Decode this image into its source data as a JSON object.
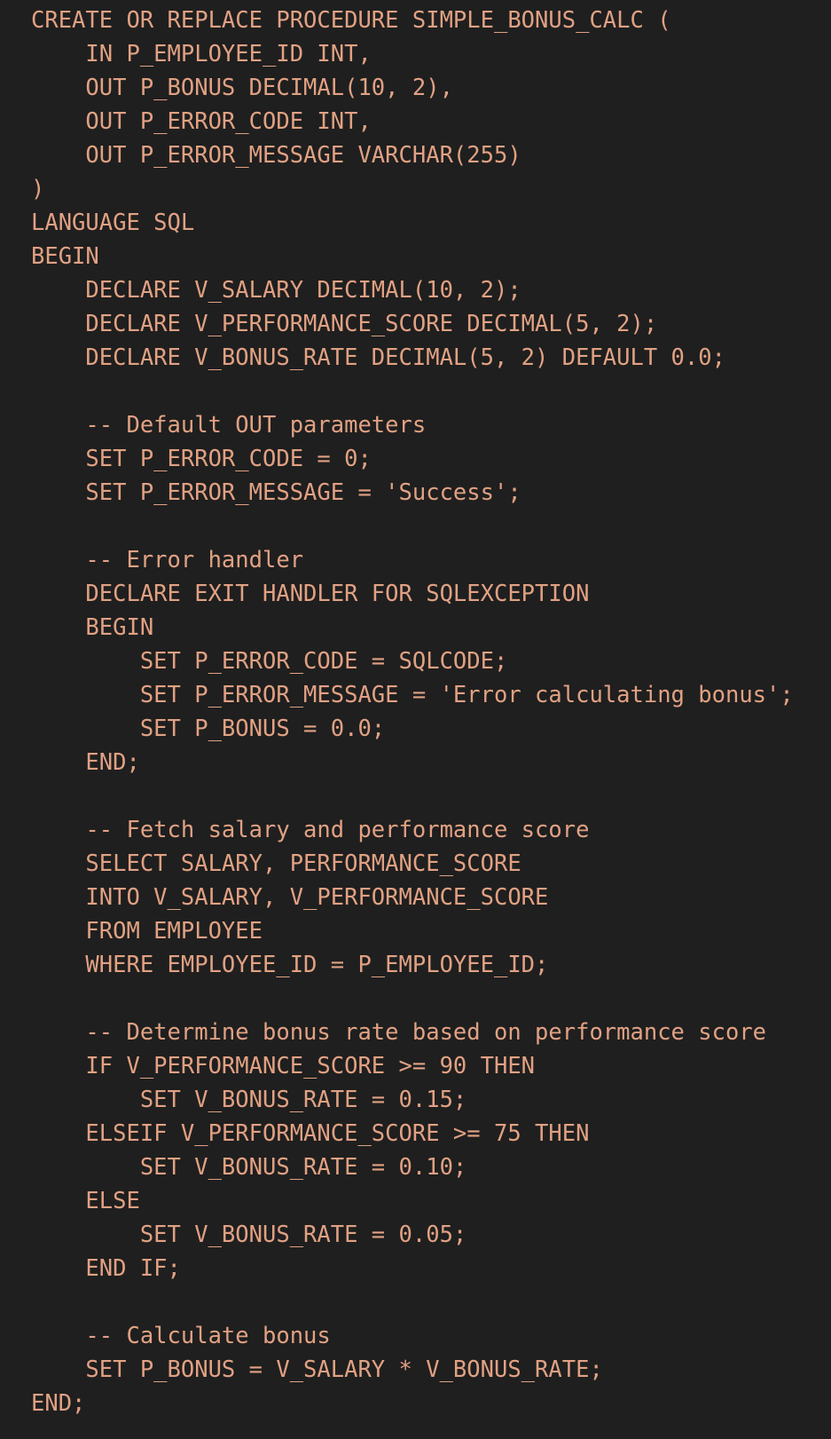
{
  "editor": {
    "colors": {
      "background": "#1f1f1f",
      "text": "#e1a183"
    },
    "lines": [
      "CREATE OR REPLACE PROCEDURE SIMPLE_BONUS_CALC (",
      "    IN P_EMPLOYEE_ID INT,",
      "    OUT P_BONUS DECIMAL(10, 2),",
      "    OUT P_ERROR_CODE INT,",
      "    OUT P_ERROR_MESSAGE VARCHAR(255)",
      ")",
      "LANGUAGE SQL",
      "BEGIN",
      "    DECLARE V_SALARY DECIMAL(10, 2);",
      "    DECLARE V_PERFORMANCE_SCORE DECIMAL(5, 2);",
      "    DECLARE V_BONUS_RATE DECIMAL(5, 2) DEFAULT 0.0;",
      "",
      "    -- Default OUT parameters",
      "    SET P_ERROR_CODE = 0;",
      "    SET P_ERROR_MESSAGE = 'Success';",
      "",
      "    -- Error handler",
      "    DECLARE EXIT HANDLER FOR SQLEXCEPTION",
      "    BEGIN",
      "        SET P_ERROR_CODE = SQLCODE;",
      "        SET P_ERROR_MESSAGE = 'Error calculating bonus';",
      "        SET P_BONUS = 0.0;",
      "    END;",
      "",
      "    -- Fetch salary and performance score",
      "    SELECT SALARY, PERFORMANCE_SCORE",
      "    INTO V_SALARY, V_PERFORMANCE_SCORE",
      "    FROM EMPLOYEE",
      "    WHERE EMPLOYEE_ID = P_EMPLOYEE_ID;",
      "",
      "    -- Determine bonus rate based on performance score",
      "    IF V_PERFORMANCE_SCORE >= 90 THEN",
      "        SET V_BONUS_RATE = 0.15;",
      "    ELSEIF V_PERFORMANCE_SCORE >= 75 THEN",
      "        SET V_BONUS_RATE = 0.10;",
      "    ELSE",
      "        SET V_BONUS_RATE = 0.05;",
      "    END IF;",
      "",
      "    -- Calculate bonus",
      "    SET P_BONUS = V_SALARY * V_BONUS_RATE;",
      "END;"
    ]
  }
}
